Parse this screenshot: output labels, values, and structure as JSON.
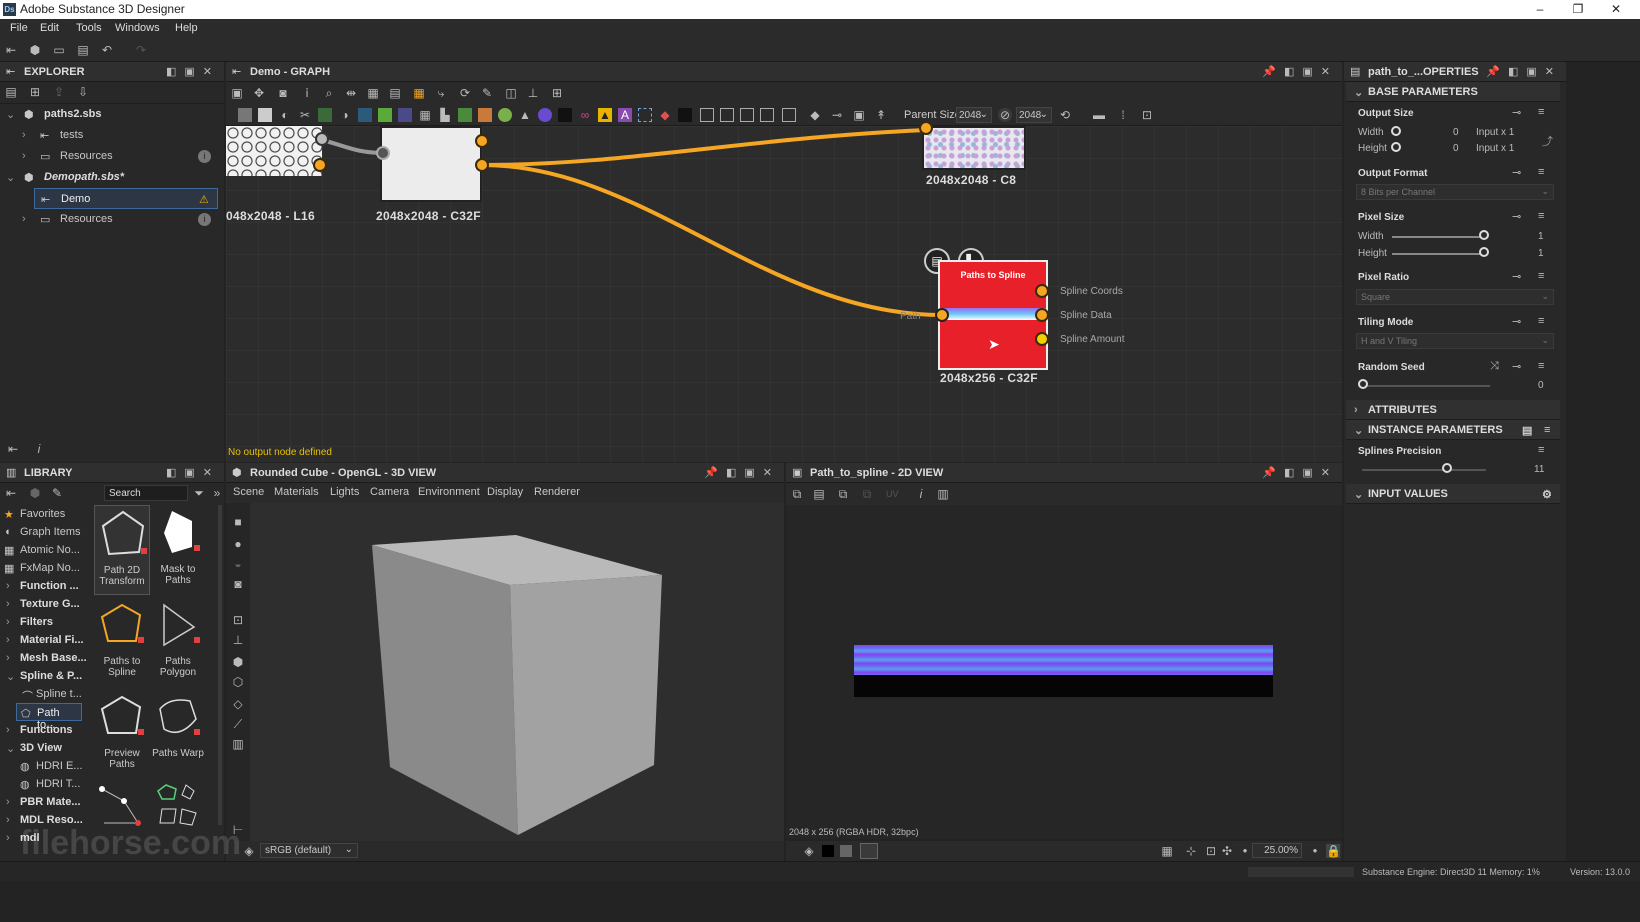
{
  "app": {
    "title": "Adobe Substance 3D Designer",
    "icon": "Ds"
  },
  "window_controls": {
    "minimize": "–",
    "maximize": "❐",
    "close": "✕"
  },
  "menu": [
    "File",
    "Edit",
    "Tools",
    "Windows",
    "Help"
  ],
  "explorer": {
    "title": "EXPLORER",
    "items": [
      {
        "label": "paths2.sbs"
      },
      {
        "label": "tests"
      },
      {
        "label": "Resources"
      },
      {
        "label": "Demopath.sbs*"
      },
      {
        "label": "Demo"
      },
      {
        "label": "Resources"
      }
    ]
  },
  "graph": {
    "title": "Demo - GRAPH",
    "parent_size_label": "Parent Size:",
    "parent_size_value": "2048",
    "size_value": "2048",
    "status": "No output node defined",
    "nodes": [
      {
        "label": "048x2048 - L16"
      },
      {
        "label": "2048x2048 - C32F"
      },
      {
        "label": "2048x2048 - C8"
      },
      {
        "label": "2048x256 - C32F",
        "name": "Paths to Spline",
        "input": "Path"
      }
    ],
    "outputs": [
      "Spline Coords",
      "Spline Data",
      "Spline Amount"
    ]
  },
  "properties": {
    "title": "path_to_...OPERTIES",
    "base_parameters": "BASE PARAMETERS",
    "output_size": {
      "label": "Output Size",
      "width_label": "Width",
      "height_label": "Height",
      "width": "0",
      "height": "0",
      "width_mode": "Input x 1",
      "height_mode": "Input x 1"
    },
    "output_format": {
      "label": "Output Format",
      "value": "8 Bits per Channel"
    },
    "pixel_size": {
      "label": "Pixel Size",
      "width_label": "Width",
      "height_label": "Height",
      "width": "1",
      "height": "1"
    },
    "pixel_ratio": {
      "label": "Pixel Ratio",
      "value": "Square"
    },
    "tiling_mode": {
      "label": "Tiling Mode",
      "value": "H and V Tiling"
    },
    "random_seed": {
      "label": "Random Seed",
      "value": "0"
    },
    "attributes": "ATTRIBUTES",
    "instance_parameters": "INSTANCE PARAMETERS",
    "splines_precision": {
      "label": "Splines Precision",
      "value": "11"
    },
    "input_values": "INPUT VALUES"
  },
  "library": {
    "title": "LIBRARY",
    "search_placeholder": "Search",
    "categories": [
      "Favorites",
      "Graph Items",
      "Atomic No...",
      "FxMap No...",
      "Function ...",
      "Texture G...",
      "Filters",
      "Material Fi...",
      "Mesh Base...",
      "Spline & P...",
      "Spline t...",
      "Path to...",
      "Functions",
      "3D View",
      "HDRI E...",
      "HDRI T...",
      "PBR Mate...",
      "MDL Reso...",
      "mdl"
    ],
    "items": [
      {
        "label": "Path 2D Transform"
      },
      {
        "label": "Mask to Paths"
      },
      {
        "label": "Paths to Spline"
      },
      {
        "label": "Paths Polygon"
      },
      {
        "label": "Preview Paths"
      },
      {
        "label": "Paths Warp"
      }
    ]
  },
  "view3d": {
    "title": "Rounded Cube - OpenGL - 3D VIEW",
    "menu": [
      "Scene",
      "Materials",
      "Lights",
      "Camera",
      "Environment",
      "Display",
      "Renderer"
    ],
    "colorspace": "sRGB (default)"
  },
  "view2d": {
    "title": "Path_to_spline - 2D VIEW",
    "info": "2048 x 256 (RGBA HDR, 32bpc)",
    "zoom": "25.00%",
    "uv": "UV"
  },
  "statusbar": {
    "engine": "Substance Engine: Direct3D 11 Memory: 1%",
    "version": "Version: 13.0.0"
  },
  "watermark": "filehorse.com",
  "colors": {
    "accent": "#f5a623",
    "node_red": "#e8202a",
    "panel": "#282828"
  }
}
